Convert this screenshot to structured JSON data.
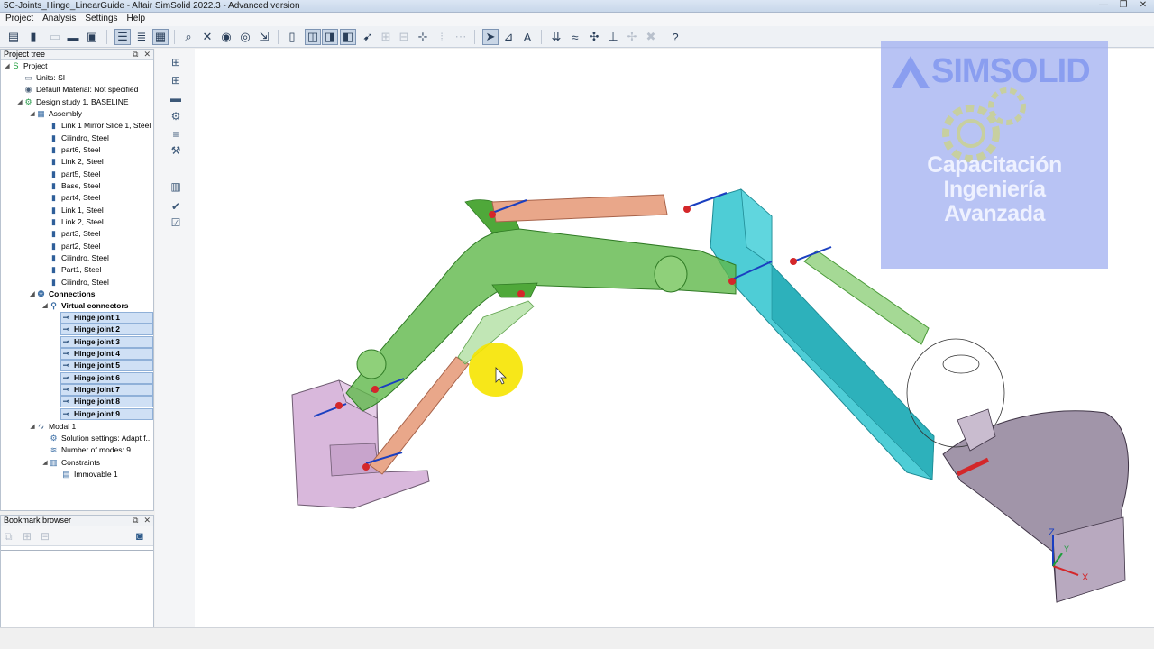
{
  "window": {
    "title": "5C-Joints_Hinge_LinearGuide - Altair SimSolid 2022.3 - Advanced version",
    "minimize": "—",
    "maximize": "❐",
    "close": "✕"
  },
  "menu": [
    "Project",
    "Analysis",
    "Settings",
    "Help"
  ],
  "project_tree": {
    "header": "Project tree",
    "items": [
      {
        "label": "Project"
      },
      {
        "label": "Units: SI"
      },
      {
        "label": "Default Material: Not specified"
      },
      {
        "label": "Design study 1, BASELINE"
      },
      {
        "label": "Assembly"
      },
      {
        "label": "Link 1 Mirror Slice 1, Steel"
      },
      {
        "label": "Cilindro, Steel"
      },
      {
        "label": "part6, Steel"
      },
      {
        "label": "Link 2, Steel"
      },
      {
        "label": "part5, Steel"
      },
      {
        "label": "Base, Steel"
      },
      {
        "label": "part4, Steel"
      },
      {
        "label": "Link 1, Steel"
      },
      {
        "label": "Link 2, Steel"
      },
      {
        "label": "part3, Steel"
      },
      {
        "label": "part2, Steel"
      },
      {
        "label": "Cilindro, Steel"
      },
      {
        "label": "Part1, Steel"
      },
      {
        "label": "Cilindro, Steel"
      },
      {
        "label": "Connections"
      },
      {
        "label": "Virtual connectors"
      },
      {
        "label": "Hinge joint 1"
      },
      {
        "label": "Hinge joint 2"
      },
      {
        "label": "Hinge joint 3"
      },
      {
        "label": "Hinge joint 4"
      },
      {
        "label": "Hinge joint 5"
      },
      {
        "label": "Hinge joint 6"
      },
      {
        "label": "Hinge joint 7"
      },
      {
        "label": "Hinge joint 8"
      },
      {
        "label": "Hinge joint 9"
      },
      {
        "label": "Modal 1"
      },
      {
        "label": "Solution settings: Adapt f..."
      },
      {
        "label": "Number of modes: 9"
      },
      {
        "label": "Constraints"
      },
      {
        "label": "Immovable 1"
      }
    ]
  },
  "bookmark_browser": {
    "header": "Bookmark browser"
  },
  "watermark": {
    "brand": "SIMSOLID",
    "line1": "Capacitación",
    "line2": "Ingeniería",
    "line3": "Avanzada"
  },
  "triad": {
    "z": "Z",
    "x": "X",
    "y": "Y"
  },
  "colors": {
    "boom_green": "#5fb84a",
    "stick_cyan": "#2fc4cf",
    "cylinder_orange": "#e9a78a",
    "base_pink": "#d9b8dc",
    "bucket_purple": "#8a7a93",
    "selection_blue": "#cfe0f5",
    "cursor_yellow": "#f6e400"
  }
}
